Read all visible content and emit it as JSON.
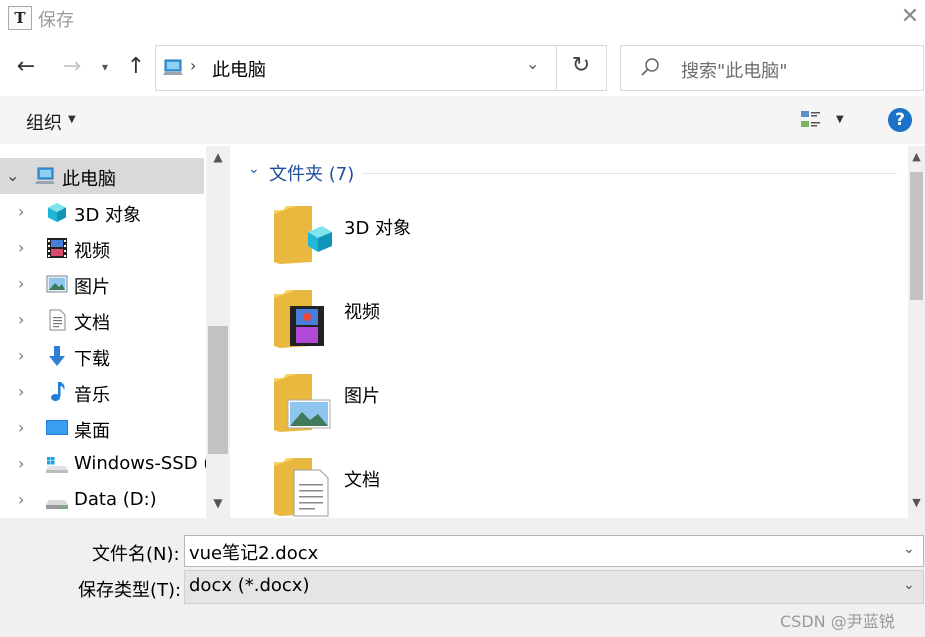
{
  "window": {
    "title": "保存",
    "app_icon_letter": "T"
  },
  "nav": {
    "back_icon": "←",
    "forward_icon": "→",
    "recent_icon": "▾",
    "up_icon": "↑",
    "address_text": "此电脑",
    "address_chevron": "›",
    "dropdown_icon": "⌄",
    "refresh_icon": "↻",
    "search_placeholder": "搜索\"此电脑\""
  },
  "toolbar": {
    "organize_label": "组织",
    "caret": "▼",
    "help_label": "?"
  },
  "tree": {
    "root": {
      "label": "此电脑",
      "expand_icon": "⌄"
    },
    "items": [
      {
        "label": "3D 对象",
        "icon": "cube-3d-icon"
      },
      {
        "label": "视频",
        "icon": "video-icon"
      },
      {
        "label": "图片",
        "icon": "picture-icon"
      },
      {
        "label": "文档",
        "icon": "document-icon"
      },
      {
        "label": "下载",
        "icon": "download-icon"
      },
      {
        "label": "音乐",
        "icon": "music-icon"
      },
      {
        "label": "桌面",
        "icon": "desktop-icon"
      },
      {
        "label": "Windows-SSD (",
        "icon": "windows-drive-icon"
      },
      {
        "label": "Data (D:)",
        "icon": "drive-icon"
      }
    ],
    "collapsed_arrow": "›"
  },
  "content": {
    "group_header": "文件夹 (7)",
    "group_chevron": "⌄",
    "folders": [
      {
        "label": "3D 对象",
        "icon": "folder-3d-objects-icon"
      },
      {
        "label": "视频",
        "icon": "folder-videos-icon"
      },
      {
        "label": "图片",
        "icon": "folder-pictures-icon"
      },
      {
        "label": "文档",
        "icon": "folder-documents-icon"
      }
    ]
  },
  "scroll": {
    "up": "▲",
    "down": "▼"
  },
  "save": {
    "filename_label": "文件名(N):",
    "filename_value": "vue笔记2.docx",
    "filetype_label": "保存类型(T):",
    "filetype_value": "docx (*.docx)"
  },
  "close_icon": "✕",
  "watermark": "CSDN @尹蓝锐",
  "colors": {
    "accent": "#1a73c8",
    "group_header": "#1e4f9c",
    "selected_bg": "#d9d9d9",
    "folder_yellow": "#f7d46b"
  }
}
